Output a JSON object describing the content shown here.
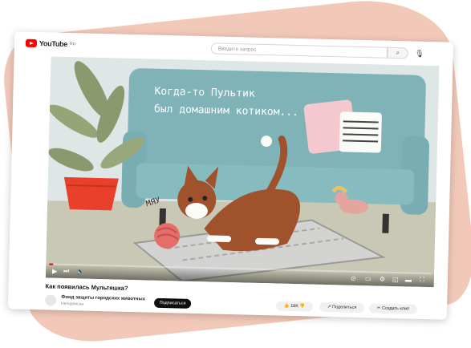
{
  "header": {
    "logo_text": "YouTube",
    "logo_sup": "RU",
    "search_placeholder": "Введите запрос",
    "search_icon": "magnifier-icon",
    "mic_icon": "mic-icon"
  },
  "video": {
    "caption_line1": "Когда-то Пультик",
    "caption_line2": "был домашним котиком...",
    "meow": "МЯУ",
    "progress_fraction": 0.01
  },
  "info": {
    "title": "Как появилась Мультяшка?",
    "channel_name": "Фонд защиты городских животных",
    "channel_sub": "Неподписан",
    "subscribe_label": "Подписаться",
    "likes": "18K",
    "share_label": "Поделиться",
    "clip_label": "Создать клип"
  },
  "colors": {
    "accent": "#ff0000",
    "sofa": "#7fb3b8",
    "wall": "#dfe7e6",
    "floor": "#c9c8b4",
    "cat": "#a0522d",
    "pot": "#e8402a",
    "blob": "#f2c9b9"
  }
}
